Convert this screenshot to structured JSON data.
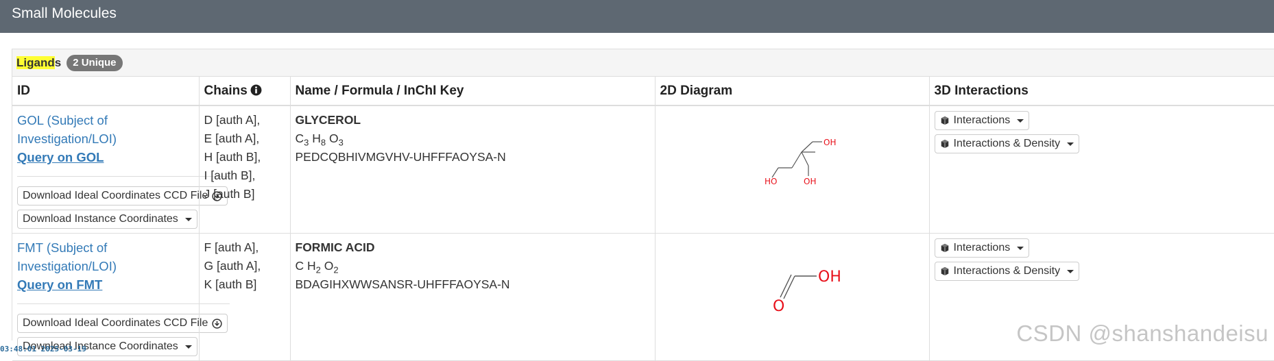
{
  "panel": {
    "title": "Small Molecules"
  },
  "caption": {
    "title_highlight": "Ligand",
    "title_rest": "s",
    "badge": "2 Unique"
  },
  "columns": {
    "id": "ID",
    "chains": "Chains",
    "name": "Name / Formula / InChI Key",
    "diagram": "2D Diagram",
    "interactions": "3D Interactions"
  },
  "rows": [
    {
      "id_text": "GOL (Subject of Investigation/LOI)",
      "query_text": "Query on GOL",
      "download_ideal": "Download Ideal Coordinates CCD File",
      "download_instance": "Download Instance Coordinates",
      "chains": [
        "D [auth A],",
        "E [auth A],",
        "H [auth B],",
        "I [auth B],",
        "J [auth B]"
      ],
      "name": "GLYCEROL",
      "formula": [
        {
          "el": "C",
          "n": "3"
        },
        {
          "el": "H",
          "n": "8"
        },
        {
          "el": "O",
          "n": "3"
        }
      ],
      "inchi": "PEDCQBHIVMGVHV-UHFFFAOYSA-N",
      "diagram_labels": [
        "OH",
        "HO",
        "OH"
      ],
      "btn_interactions": "Interactions",
      "btn_density": "Interactions & Density"
    },
    {
      "id_text": "FMT (Subject of Investigation/LOI)",
      "query_text": "Query on FMT",
      "download_ideal": "Download Ideal Coordinates CCD File",
      "download_instance": "Download Instance Coordinates",
      "chains": [
        "F [auth A],",
        "G [auth A],",
        "K [auth B]"
      ],
      "name": "FORMIC ACID",
      "formula": [
        {
          "el": "C",
          "n": ""
        },
        {
          "el": "H",
          "n": "2"
        },
        {
          "el": "O",
          "n": "2"
        }
      ],
      "inchi": "BDAGIHXWWSANSR-UHFFFAOYSA-N",
      "diagram_labels": [
        "OH",
        "O"
      ],
      "btn_interactions": "Interactions",
      "btn_density": "Interactions & Density"
    }
  ],
  "footer": {
    "timestamp": "03:48:01 2025-03-19"
  },
  "watermark": "CSDN @shanshandeisu",
  "colors": {
    "header_bg": "#5e6872",
    "link": "#337ab7",
    "highlight": "#ffff33",
    "atom": "#e8101a",
    "badge": "#777777"
  }
}
